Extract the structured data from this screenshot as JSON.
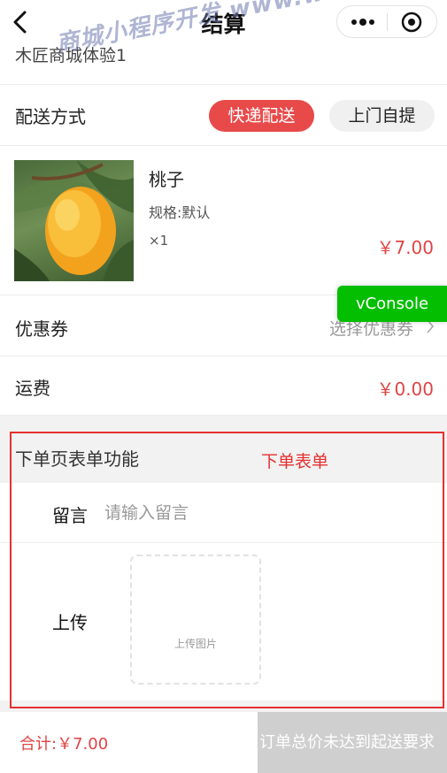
{
  "nav": {
    "title": "结算"
  },
  "store": {
    "name": "木匠商城体验1"
  },
  "watermark": "商城小程序开发 www.weike.cc",
  "delivery": {
    "label": "配送方式",
    "options": [
      "快递配送",
      "上门自提"
    ],
    "selected": "快递配送"
  },
  "product": {
    "name": "桃子",
    "spec": "规格:默认",
    "qty": "×1",
    "price": "￥7.00"
  },
  "vconsole": {
    "label": "vConsole"
  },
  "coupon": {
    "label": "优惠券",
    "value": "选择优惠券"
  },
  "shipping": {
    "label": "运费",
    "value": "￥0.00"
  },
  "form": {
    "title": "下单页表单功能",
    "annotation": "下单表单",
    "remark_label": "留言",
    "remark_placeholder": "请输入留言",
    "upload_label": "上传",
    "upload_text": "上传图片"
  },
  "footer": {
    "total": "合计:￥7.00",
    "submit": "订单总价未达到起送要求"
  },
  "colors": {
    "accent": "#e84a4a",
    "price": "#e04545",
    "annotation": "#e53030",
    "vconsole": "#04be02",
    "disabled": "#cfcfcf"
  }
}
